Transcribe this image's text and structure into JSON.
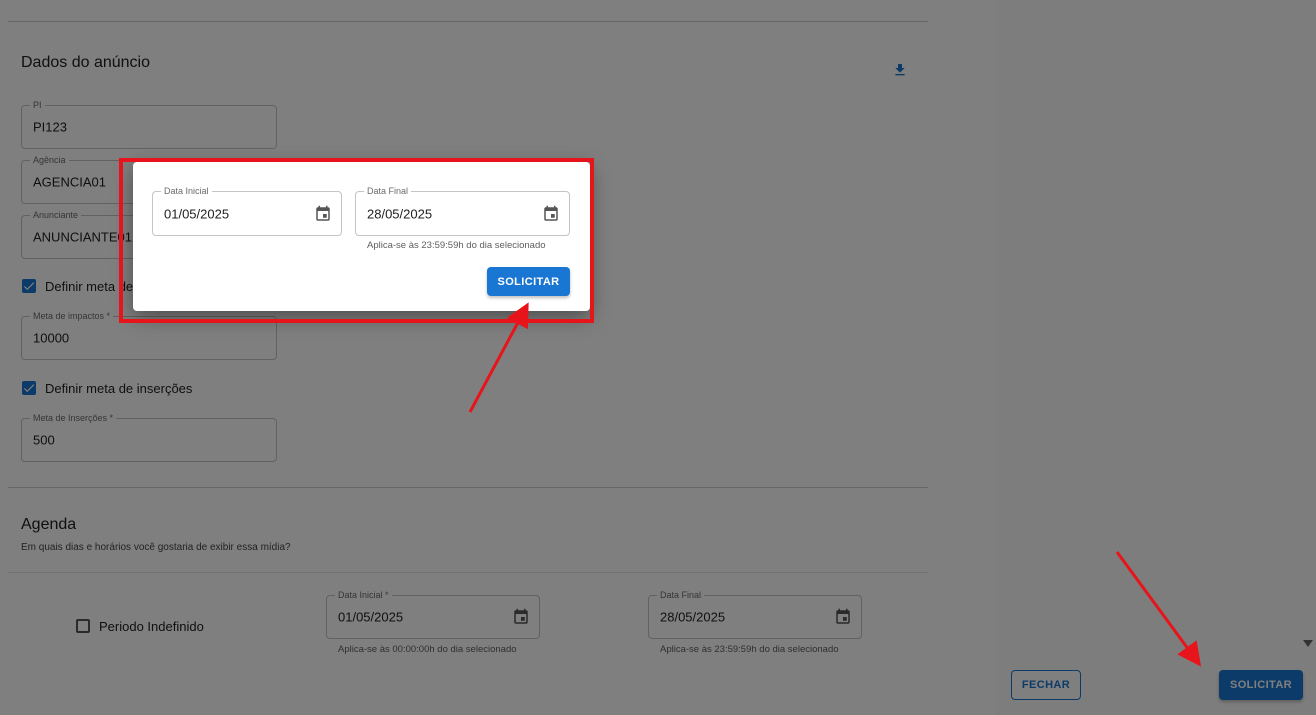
{
  "form": {
    "ad_section_title": "Dados do anúncio",
    "pi": {
      "label": "PI",
      "value": "PI123"
    },
    "agencia": {
      "label": "Agência",
      "value": "AGENCIA01"
    },
    "anunciante": {
      "label": "Anunciante",
      "value": "ANUNCIANTE01"
    },
    "meta_impactos_checkbox": "Definir meta de impactos",
    "meta_impactos": {
      "label": "Meta de impactos *",
      "value": "10000"
    },
    "meta_insercoes_checkbox": "Definir meta de inserções",
    "meta_insercoes": {
      "label": "Meta de Inserções *",
      "value": "500"
    },
    "agenda_title": "Agenda",
    "agenda_subtitle": "Em quais dias e horários você gostaria de exibir essa mídia?",
    "periodo_indefinido": "Periodo Indefinido",
    "data_inicial": {
      "label": "Data Inicial *",
      "value": "01/05/2025",
      "helper": "Aplica-se às 00:00:00h do dia selecionado"
    },
    "data_final": {
      "label": "Data Final",
      "value": "28/05/2025",
      "helper": "Aplica-se às 23:59:59h do dia selecionado"
    }
  },
  "drawer": {
    "close_label": "FECHAR",
    "submit_label": "SOLICITAR"
  },
  "dialog": {
    "start_date": {
      "label": "Data Inicial",
      "value": "01/05/2025"
    },
    "end_date": {
      "label": "Data Final",
      "value": "28/05/2025",
      "helper": "Aplica-se às 23:59:59h do dia selecionado"
    },
    "submit_label": "SOLICITAR"
  },
  "colors": {
    "primary": "#1976d2",
    "highlight": "#e8141b",
    "overlay": "rgba(0,0,0,0.5)"
  },
  "icons": [
    "download-icon",
    "calendar-icon",
    "checkbox-checked-icon",
    "checkbox-unchecked-icon",
    "dropdown-triangle-icon",
    "annotation-arrow"
  ]
}
